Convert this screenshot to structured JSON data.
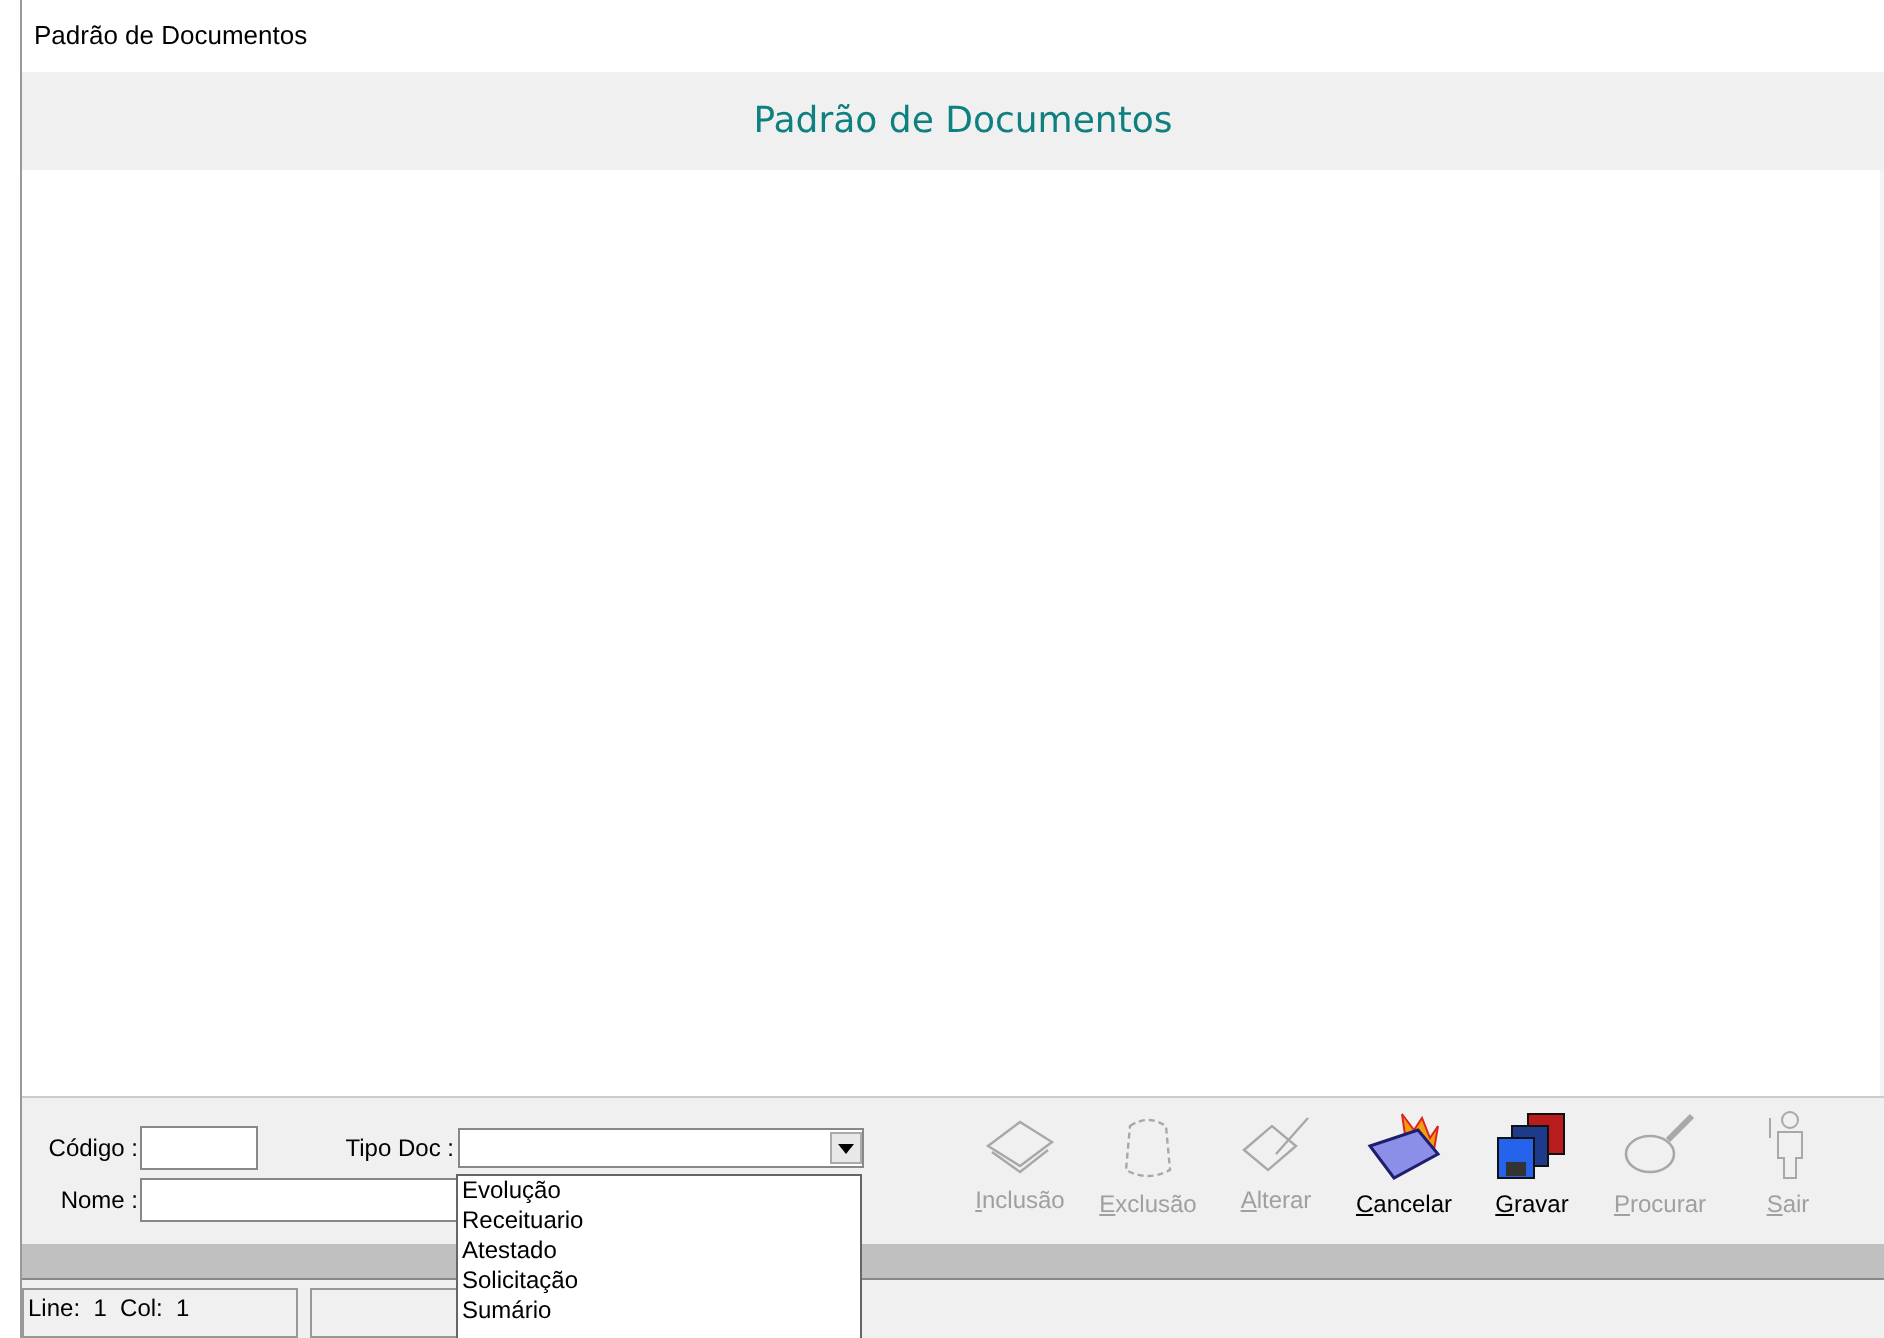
{
  "window": {
    "title": "Padrão de Documentos"
  },
  "header": {
    "title": "Padrão de Documentos"
  },
  "form": {
    "codigo_label": "Código :",
    "nome_label": "Nome :",
    "tipo_doc_label": "Tipo Doc :",
    "tipo_doc": {
      "expanded": true,
      "options": [
        "Evolução",
        "Receituario",
        "Atestado",
        "Solicitação",
        "Sumário"
      ]
    }
  },
  "toolbar": [
    {
      "kind": "inclusao",
      "label": "Inclusão",
      "disabled": true
    },
    {
      "kind": "exclusao",
      "label": "Exclusão",
      "disabled": true
    },
    {
      "kind": "alterar",
      "label": "Alterar",
      "disabled": true
    },
    {
      "kind": "cancelar",
      "label": "Cancelar",
      "disabled": false
    },
    {
      "kind": "gravar",
      "label": "Gravar",
      "disabled": false
    },
    {
      "kind": "procurar",
      "label": "Procurar",
      "disabled": true
    },
    {
      "kind": "sair",
      "label": "Sair",
      "disabled": true
    }
  ],
  "status_bar": {
    "position": "Line:  1  Col:  1"
  }
}
